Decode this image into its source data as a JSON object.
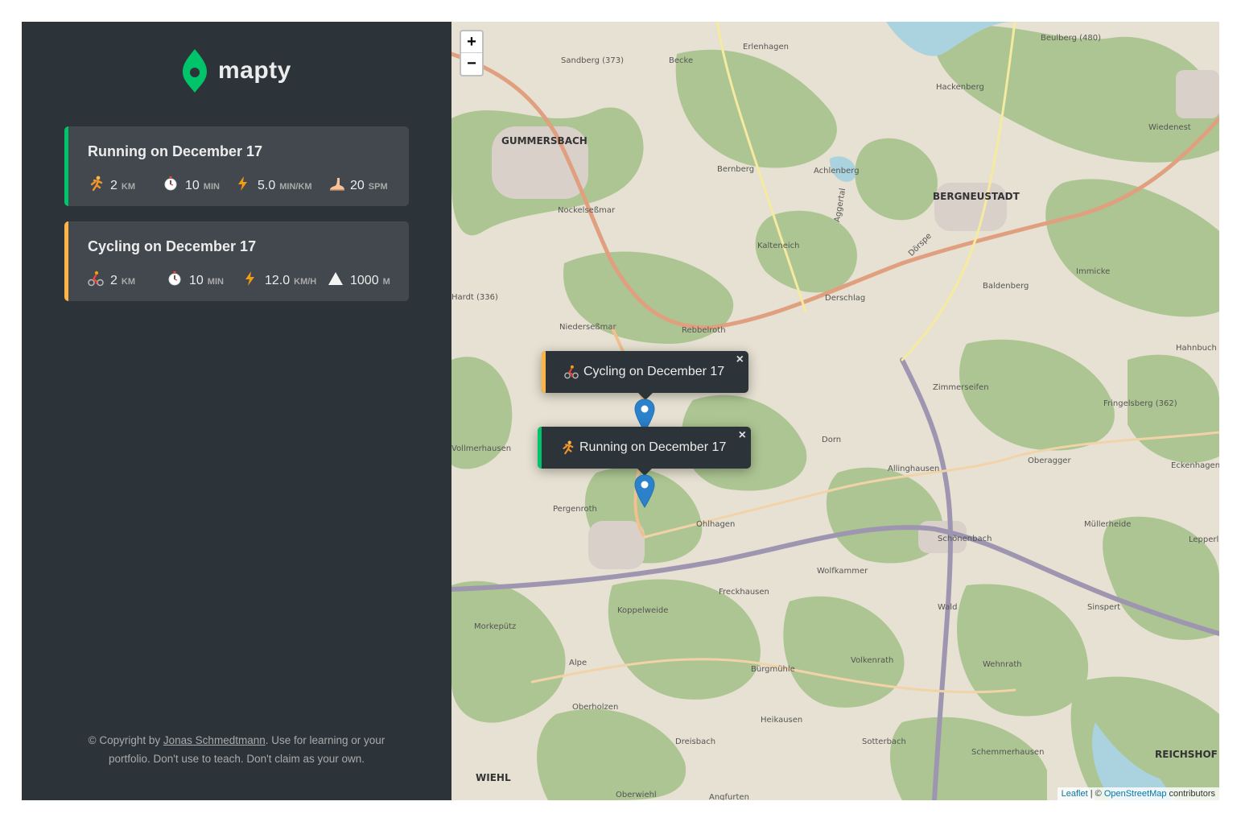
{
  "logo": {
    "text": "mapty",
    "icon": "map-pin-icon"
  },
  "workouts": [
    {
      "type": "running",
      "color": "#00c46a",
      "title": "Running on December 17",
      "details": [
        {
          "icon": "runner-icon",
          "value": "2",
          "unit": "km"
        },
        {
          "icon": "stopwatch-icon",
          "value": "10",
          "unit": "min"
        },
        {
          "icon": "lightning-icon",
          "value": "5.0",
          "unit": "min/km"
        },
        {
          "icon": "foot-icon",
          "value": "20",
          "unit": "spm"
        }
      ]
    },
    {
      "type": "cycling",
      "color": "#ffb545",
      "title": "Cycling on December 17",
      "details": [
        {
          "icon": "cyclist-icon",
          "value": "2",
          "unit": "km"
        },
        {
          "icon": "stopwatch-icon",
          "value": "10",
          "unit": "min"
        },
        {
          "icon": "lightning-icon",
          "value": "12.0",
          "unit": "km/h"
        },
        {
          "icon": "mountain-icon",
          "value": "1000",
          "unit": "m"
        }
      ]
    }
  ],
  "copyright": {
    "prefix": "© Copyright by ",
    "author": "Jonas Schmedtmann",
    "suffix": ". Use for learning or your portfolio. Don't use to teach. Don't claim as your own."
  },
  "map": {
    "zoom_in": "+",
    "zoom_out": "−",
    "popups": [
      {
        "icon": "cyclist-icon",
        "label": "Cycling on December 17",
        "close": "×"
      },
      {
        "icon": "runner-icon",
        "label": "Running on December 17",
        "close": "×"
      }
    ],
    "attribution": {
      "leaflet": "Leaflet",
      "sep": " | © ",
      "osm": "OpenStreetMap",
      "suffix": " contributors"
    },
    "place_labels": [
      "GUMMERSBACH",
      "BERGNEUSTADT",
      "Hackenberg",
      "Erlenhagen",
      "Sandberg (373)",
      "Becke",
      "Beulberg (480)",
      "Wiedenest",
      "Bernberg",
      "Achlenberg",
      "Nockelseßmar",
      "Kalteneich",
      "Baldenberg",
      "Immicke",
      "Hardt (336)",
      "Derschlag",
      "Niederseßmar",
      "Rebbelroth",
      "Hahnbuch",
      "Zimmerseifen",
      "Fringelsberg (362)",
      "Vollmerhausen",
      "Dorn",
      "Allinghausen",
      "Oberagger",
      "Eckenhagen",
      "Pergenroth",
      "Ohlhagen",
      "Schönenbach",
      "Müllerheide",
      "Lepperl",
      "Wolfkammer",
      "Freckhausen",
      "Koppelweide",
      "Morkepütz",
      "Wald",
      "Sinspert",
      "Alpe",
      "Bürgmühle",
      "Volkenrath",
      "Wehnrath",
      "Oberholzen",
      "Heikausen",
      "Dreisbach",
      "Sotterbach",
      "Schemmerhausen",
      "REICHSHOF",
      "WIEHL",
      "Oberwiehl",
      "Angfurten",
      "Aggertal",
      "Dörspe"
    ]
  }
}
